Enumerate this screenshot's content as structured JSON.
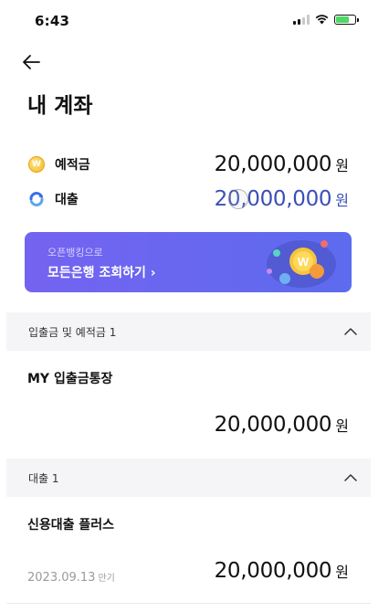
{
  "status": {
    "time": "6:43"
  },
  "header": {
    "title": "내 계좌"
  },
  "summary": {
    "deposit": {
      "label": "예적금",
      "amount": "20,000,000",
      "unit": "원",
      "icon": "coin-icon"
    },
    "loan": {
      "label": "대출",
      "amount": "20,000,000",
      "unit": "원",
      "icon": "loan-icon"
    }
  },
  "banner": {
    "subtitle": "오픈뱅킹으로",
    "title": "모든은행 조회하기 ›"
  },
  "sections": [
    {
      "label": "입출금 및 예적금 1",
      "account_name": "MY 입출금통장",
      "amount": "20,000,000",
      "unit": "원"
    },
    {
      "label": "대출 1",
      "account_name": "신용대출 플러스",
      "amount": "20,000,000",
      "unit": "원",
      "maturity_date": "2023.09.13",
      "maturity_label": "만기"
    }
  ],
  "colors": {
    "banner": "#6a66f0",
    "loan_amount": "#3b4fb5",
    "section_bg": "#f5f5f7"
  }
}
